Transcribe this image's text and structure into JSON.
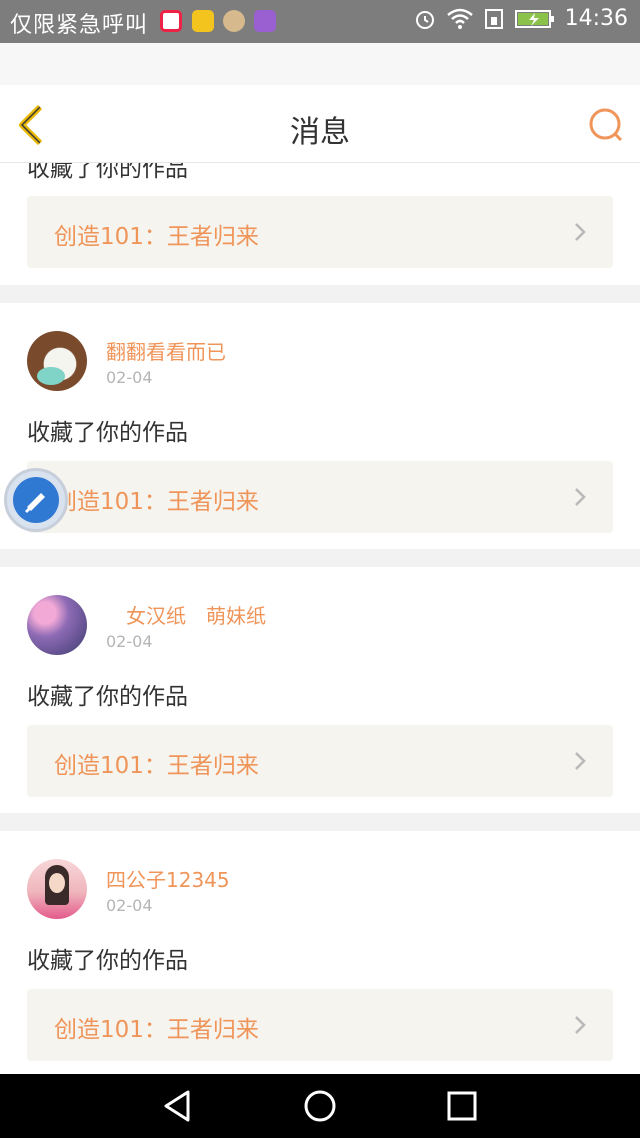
{
  "status_bar": {
    "carrier_text": "仅限紧急呼叫",
    "time": "14:36",
    "icons": [
      "sogou-icon",
      "app-icon",
      "app-icon",
      "gallery-icon",
      "alarm-icon",
      "wifi-icon",
      "sim-icon",
      "battery-charging-icon"
    ]
  },
  "header": {
    "title": "消息"
  },
  "partial_top": {
    "action_text": "收藏了你的作品",
    "work_title": "创造101：王者归来"
  },
  "messages": [
    {
      "name": "翻翻看看而已",
      "date": "02-04",
      "action_text": "收藏了你的作品",
      "work_title": "创造101：王者归来"
    },
    {
      "name": " 女汉纸 萌妹纸",
      "date": "02-04",
      "action_text": "收藏了你的作品",
      "work_title": "创造101：王者归来"
    },
    {
      "name": "四公子12345",
      "date": "02-04",
      "action_text": "收藏了你的作品",
      "work_title": "创造101：王者归来"
    }
  ],
  "colors": {
    "accent": "#f0955a",
    "back_arrow": "#e9b600",
    "work_bg": "#f5f4ee"
  }
}
